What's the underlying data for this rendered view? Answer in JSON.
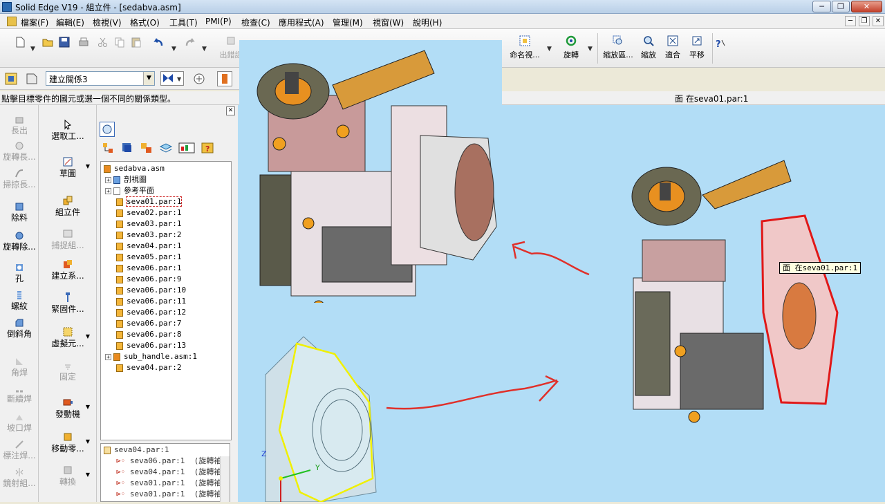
{
  "window": {
    "title": "Solid Edge V19 - 組立件 - [sedabva.asm]"
  },
  "menu": [
    "檔案(F)",
    "編輯(E)",
    "檢視(V)",
    "格式(O)",
    "工具(T)",
    "PMI(P)",
    "檢查(C)",
    "應用程式(A)",
    "管理(M)",
    "視窗(W)",
    "說明(H)"
  ],
  "toolbar": {
    "buttons": [
      "出錯誤",
      "命名視...",
      "旋轉",
      "縮放區...",
      "縮放",
      "適合",
      "平移"
    ]
  },
  "toolbar2": {
    "relationship_combo": "建立關係3"
  },
  "status": {
    "prompt": "點擊目標零件的圖元或選一個不同的關係類型。",
    "selection": "面 在seva01.par:1"
  },
  "leftbar": [
    "長出",
    "旋轉長...",
    "掃掠長...",
    "除料",
    "旋轉除...",
    "孔",
    "螺紋",
    "倒斜角",
    "角焊",
    "斷續焊",
    "坡口焊",
    "標注焊...",
    "鏡射組..."
  ],
  "leftbar2": [
    "選取工...",
    "草圖",
    "組立件",
    "捕捉組...",
    "建立系...",
    "緊固件...",
    "虛擬元...",
    "固定",
    "發動機",
    "移動零...",
    "轉換"
  ],
  "tree": {
    "root": "sedabva.asm",
    "items": [
      {
        "label": "剖視圖",
        "expandable": true
      },
      {
        "label": "參考平面",
        "expandable": true
      },
      {
        "label": "seva01.par:1",
        "selected": true
      },
      {
        "label": "seva02.par:1"
      },
      {
        "label": "seva03.par:1"
      },
      {
        "label": "seva03.par:2"
      },
      {
        "label": "seva04.par:1"
      },
      {
        "label": "seva05.par:1"
      },
      {
        "label": "seva06.par:1"
      },
      {
        "label": "seva06.par:9"
      },
      {
        "label": "seva06.par:10"
      },
      {
        "label": "seva06.par:11"
      },
      {
        "label": "seva06.par:12"
      },
      {
        "label": "seva06.par:7"
      },
      {
        "label": "seva06.par:8"
      },
      {
        "label": "seva06.par:13"
      },
      {
        "label": "sub_handle.asm:1",
        "expandable": true
      },
      {
        "label": "seva04.par:2"
      }
    ]
  },
  "relations": {
    "header": "seva04.par:1",
    "rows": [
      {
        "part": "seva06.par:1",
        "type": "(旋轉袖"
      },
      {
        "part": "seva04.par:1",
        "type": "(旋轉袖"
      },
      {
        "part": "seva01.par:1",
        "type": "(旋轉袖"
      },
      {
        "part": "seva01.par:1",
        "type": "(旋轉袖"
      }
    ]
  },
  "tooltip": "面 在seva01.par:1",
  "colors": {
    "canvas": "#b2ddf6",
    "annotation": "#e0302a",
    "selection": "#e01818",
    "highlight": "#f0f000"
  },
  "icons": [
    "new-icon",
    "open-icon",
    "save-icon",
    "print-icon",
    "cut-icon",
    "copy-icon",
    "paste-icon",
    "undo-icon",
    "redo-icon",
    "help-icon"
  ]
}
